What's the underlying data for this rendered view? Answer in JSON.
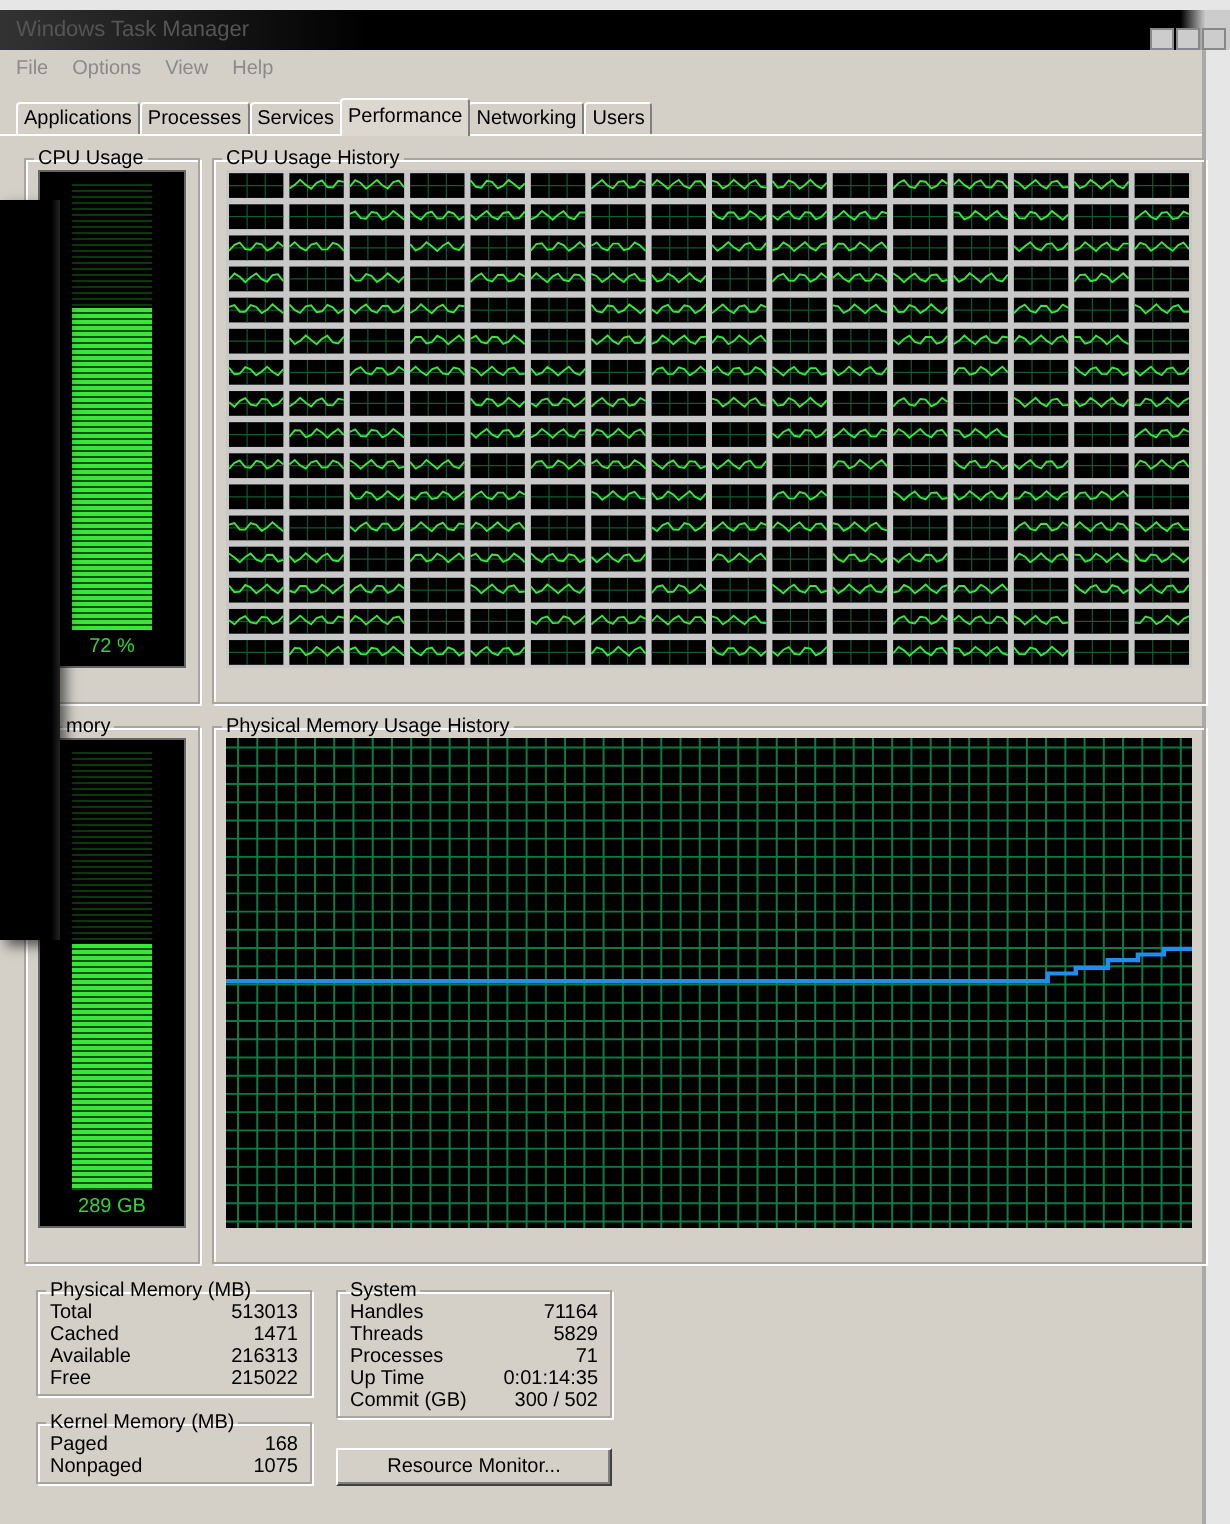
{
  "window": {
    "title": "Windows Task Manager"
  },
  "menu": [
    "File",
    "Options",
    "View",
    "Help"
  ],
  "tabs": [
    {
      "label": "Applications",
      "selected": false
    },
    {
      "label": "Processes",
      "selected": false
    },
    {
      "label": "Services",
      "selected": false
    },
    {
      "label": "Performance",
      "selected": true
    },
    {
      "label": "Networking",
      "selected": false
    },
    {
      "label": "Users",
      "selected": false
    }
  ],
  "cpu_usage": {
    "title": "CPU Usage",
    "level": 0.72,
    "reading": "72 %"
  },
  "cpu_history": {
    "title": "CPU Usage History"
  },
  "memory": {
    "title": "mory",
    "level": 0.56,
    "reading": "289 GB"
  },
  "memory_history": {
    "title": "Physical Memory Usage History"
  },
  "physical_memory": {
    "title": "Physical Memory (MB)",
    "rows": [
      {
        "label": "Total",
        "value": "513013"
      },
      {
        "label": "Cached",
        "value": "1471"
      },
      {
        "label": "Available",
        "value": "216313"
      },
      {
        "label": "Free",
        "value": "215022"
      }
    ]
  },
  "kernel_memory": {
    "title": "Kernel Memory (MB)",
    "rows": [
      {
        "label": "Paged",
        "value": "168"
      },
      {
        "label": "Nonpaged",
        "value": "1075"
      }
    ]
  },
  "system": {
    "title": "System",
    "rows": [
      {
        "label": "Handles",
        "value": "71164"
      },
      {
        "label": "Threads",
        "value": "5829"
      },
      {
        "label": "Processes",
        "value": "71"
      },
      {
        "label": "Up Time",
        "value": "0:01:14:35"
      },
      {
        "label": "Commit (GB)",
        "value": "300 / 502"
      }
    ]
  },
  "resource_monitor_button": "Resource Monitor..."
}
